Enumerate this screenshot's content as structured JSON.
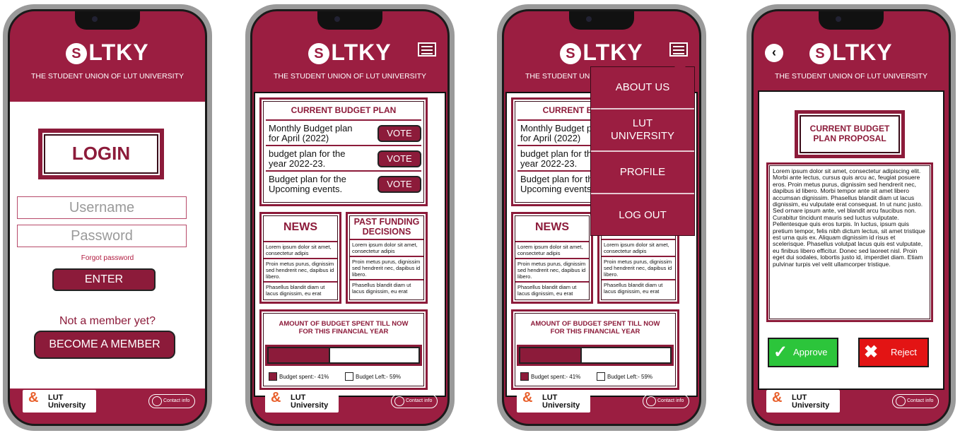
{
  "brand": {
    "name": "LTKY",
    "subtitle": "THE STUDENT UNION OF LUT UNIVERSITY",
    "logo_glyph": "S"
  },
  "footer": {
    "university_line1": "LUT",
    "university_line2": "University",
    "contact_label": "Contact info"
  },
  "login": {
    "title": "LOGIN",
    "username_placeholder": "Username",
    "password_placeholder": "Password",
    "forgot_password": "Forgot password",
    "enter_label": "ENTER",
    "member_question": "Not a member yet?",
    "become_member_label": "BECOME A MEMBER"
  },
  "dashboard": {
    "budget_title": "CURRENT BUDGET PLAN",
    "budget_items": [
      {
        "line1": "Monthly Budget plan",
        "line2": "for April (2022)",
        "vote": "VOTE"
      },
      {
        "line1": "budget plan for the",
        "line2": "year 2022-23.",
        "vote": "VOTE"
      },
      {
        "line1": "Budget plan for the",
        "line2": "Upcoming events.",
        "vote": "VOTE"
      }
    ],
    "news_title": "NEWS",
    "past_funding_title_1": "PAST FUNDING",
    "past_funding_title_2": "DECISIONS",
    "news_items": [
      "Lorem ipsum dolor sit amet, consectetur adipis",
      "Proin metus purus, dignissim sed hendrerit nec, dapibus id libero.",
      "Phasellus blandit diam ut lacus dignissim, eu erat"
    ],
    "spent_title_1": "AMOUNT OF BUDGET SPENT TILL NOW",
    "spent_title_2": "FOR THIS FINANCIAL YEAR",
    "spent_fraction": 0.41,
    "budget_spent_label": "Budget spent:- 41%",
    "budget_left_label": "Budget Left:- 59%",
    "colors": {
      "accent": "#8c1b3a",
      "background": "#9b1e41"
    }
  },
  "menu": {
    "items": [
      "ABOUT US",
      "LUT UNIVERSITY",
      "PROFILE",
      "LOG OUT"
    ]
  },
  "proposal": {
    "title_1": "CURRENT BUDGET",
    "title_2": "PLAN PROPOSAL",
    "body": "Lorem ipsum dolor sit amet, consectetur adipiscing elit. Morbi ante lectus, cursus quis arcu ac, feugiat posuere eros. Proin metus purus, dignissim sed hendrerit nec, dapibus id libero. Morbi tempor ante sit amet libero accumsan dignissim. Phasellus blandit diam ut lacus dignissim, eu vulputate erat consequat. In ut nunc justo. Sed ornare ipsum ante, vel blandit arcu faucibus non. Curabitur tincidunt mauris sed luctus vulputate. Pellentesque quis eros turpis. In luctus, ipsum quis pretium tempor, felis nibh dictum lectus, sit amet tristique est urna quis ex. Aliquam dignissim id risus et scelerisque. Phasellus volutpat lacus quis est vulputate, eu finibus libero efficitur. Donec sed laoreet nisl. Proin eget dui sodales, lobortis justo id, imperdiet diam. Etiam pulvinar turpis vel velit ullamcorper tristique.",
    "approve_label": "Approve",
    "reject_label": "Reject",
    "approve_icon": "check-icon",
    "reject_icon": "x-icon",
    "colors": {
      "approve": "#2cc53b",
      "reject": "#e31414"
    }
  }
}
